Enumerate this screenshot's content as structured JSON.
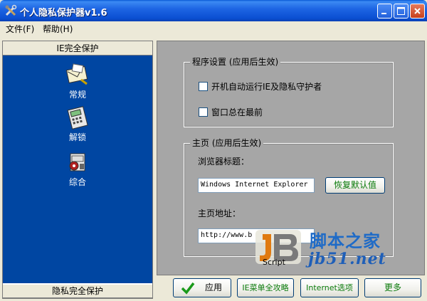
{
  "window": {
    "title": "个人隐私保护器v1.6"
  },
  "menu": {
    "file": "文件(F)",
    "help": "帮助(H)"
  },
  "left": {
    "header": "IE完全保护",
    "footer": "隐私完全保护",
    "items": [
      {
        "label": "常规",
        "icon": "envelope-icon"
      },
      {
        "label": "解锁",
        "icon": "calculator-icon"
      },
      {
        "label": "综合",
        "icon": "gear-phone-icon"
      }
    ]
  },
  "settings": {
    "legend": "程序设置 (应用后生效)",
    "autostart_label": "开机自动运行IE及隐私守护者",
    "ontop_label": "窗口总在最前"
  },
  "homepage": {
    "legend": "主页 (应用后生效)",
    "browser_title_label": "浏览器标题：",
    "browser_title_value": "Windows Internet Explorer",
    "restore_default_button": "恢复默认值",
    "homepage_url_label": "主页地址：",
    "homepage_url_value": "http://www.b"
  },
  "buttons": {
    "apply": "应用",
    "ie_menu": "IE菜单全攻略",
    "internet_options": "Internet选项",
    "more": "更多"
  },
  "watermark": {
    "site_cn": "脚本之家",
    "site_url": "jb51.net",
    "logo_word": "Script"
  }
}
